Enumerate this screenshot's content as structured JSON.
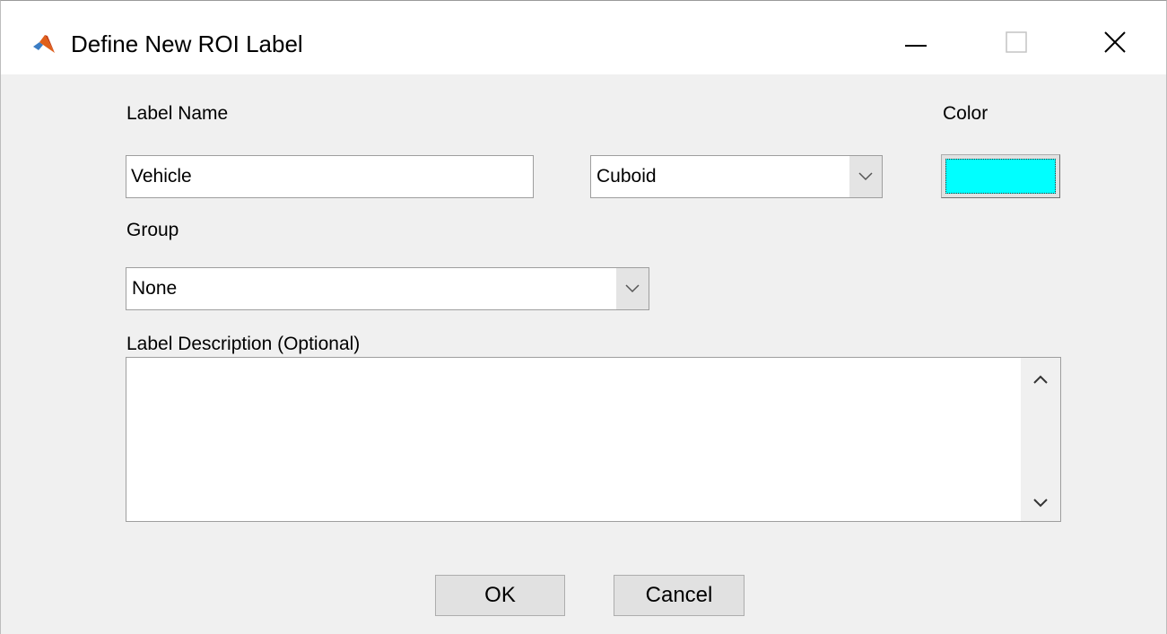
{
  "window": {
    "title": "Define New ROI Label",
    "icon": "matlab-logo-icon",
    "controls": [
      "minimize-icon",
      "maximize-icon",
      "close-icon"
    ]
  },
  "form": {
    "label_name_caption": "Label Name",
    "label_name_value": "Vehicle",
    "type_selected": "Cuboid",
    "color_caption": "Color",
    "color_value": "#00ffff",
    "group_caption": "Group",
    "group_selected": "None",
    "description_caption": "Label Description (Optional)",
    "description_value": ""
  },
  "buttons": {
    "ok": "OK",
    "cancel": "Cancel"
  }
}
